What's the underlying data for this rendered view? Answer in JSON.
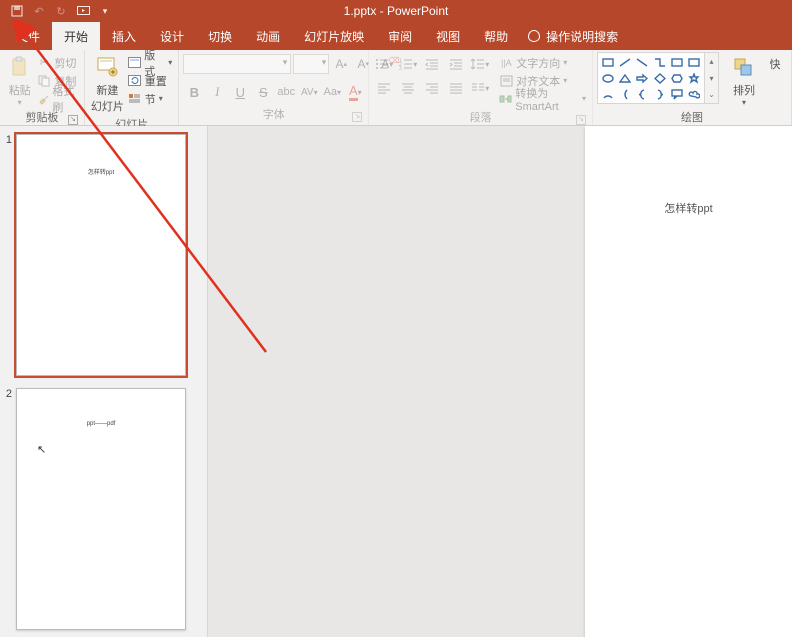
{
  "app": {
    "title": "1.pptx - PowerPoint"
  },
  "tabs": {
    "file": "文件",
    "home": "开始",
    "insert": "插入",
    "design": "设计",
    "transitions": "切换",
    "animations": "动画",
    "slideshow": "幻灯片放映",
    "review": "审阅",
    "view": "视图",
    "help": "帮助",
    "tellme": "操作说明搜索"
  },
  "ribbon": {
    "clipboard": {
      "label": "剪贴板",
      "paste": "粘贴",
      "cut": "剪切",
      "copy": "复制",
      "format_painter": "格式刷"
    },
    "slides": {
      "label": "幻灯片",
      "new_slide_l1": "新建",
      "new_slide_l2": "幻灯片",
      "layout": "版式",
      "reset": "重置",
      "section": "节"
    },
    "font": {
      "label": "字体"
    },
    "paragraph": {
      "label": "段落",
      "text_direction": "文字方向",
      "align_text": "对齐文本",
      "smartart": "转换为 SmartArt"
    },
    "drawing": {
      "label": "绘图",
      "arrange": "排列",
      "quick": "快"
    }
  },
  "thumbs": {
    "n1": "1",
    "n2": "2",
    "t1": "怎样转ppt",
    "t2": "ppt——pdf"
  },
  "slide": {
    "text": "怎样转ppt"
  }
}
